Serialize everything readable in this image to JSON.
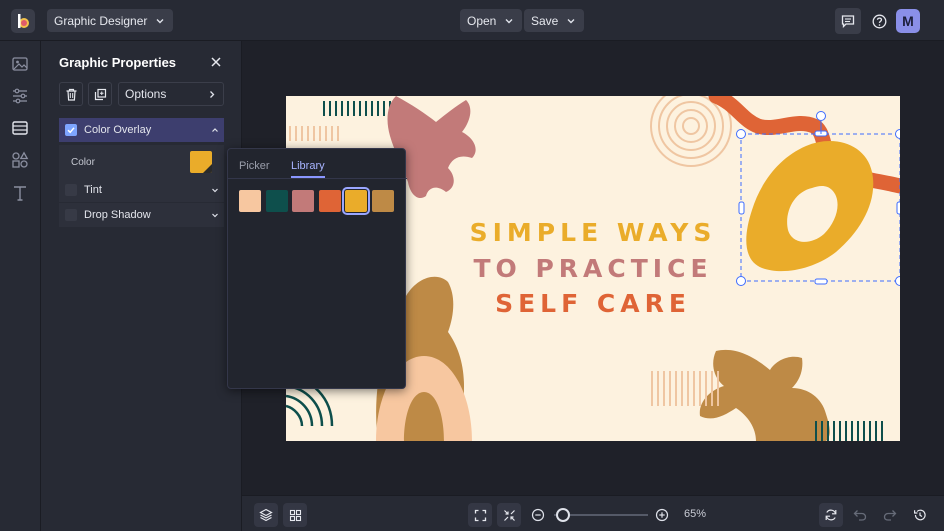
{
  "header": {
    "app_menu_label": "Graphic Designer",
    "open_label": "Open",
    "save_label": "Save",
    "avatar_initial": "M"
  },
  "side_rail": {
    "icons": [
      "image-icon",
      "sliders-icon",
      "background-icon",
      "shapes-icon",
      "text-icon"
    ]
  },
  "panel": {
    "title": "Graphic Properties",
    "options_label": "Options",
    "color_overlay_label": "Color Overlay",
    "color_overlay_checked": true,
    "color_label": "Color",
    "current_color": "#eaac2a",
    "tint_label": "Tint",
    "drop_shadow_label": "Drop Shadow"
  },
  "color_popup": {
    "tabs": [
      "Picker",
      "Library"
    ],
    "active_tab": "Library",
    "swatches": [
      "#f7c7a0",
      "#0e4f4c",
      "#c27a79",
      "#df6436",
      "#eaac2a",
      "#be8a46"
    ],
    "selected_index": 4
  },
  "canvas": {
    "headline_lines": [
      "SIMPLE WAYS",
      "TO PRACTICE",
      "SELF CARE"
    ],
    "line_colors": [
      "#eaac2a",
      "#c27a79",
      "#df6436"
    ]
  },
  "bottom_bar": {
    "zoom_value": "65%",
    "zoom_fraction": 0.1
  },
  "colors": {
    "accent": "#8a8fe8",
    "overlay_row_bg": "#3d3e6e",
    "canvas_bg": "#fdf2df"
  }
}
